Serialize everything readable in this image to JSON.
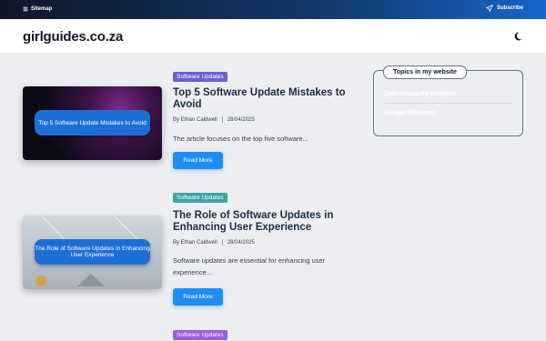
{
  "topbar": {
    "sitemap_label": "Sitemap",
    "subscribe_label": "Subscribe"
  },
  "header": {
    "logo": "girlguides.co.za"
  },
  "posts": [
    {
      "tag": "Software Updates",
      "title": "Top 5 Software Update Mistakes to Avoid",
      "thumb_text": "Top 5 Software Update Mistakes to Avoid",
      "author": "By Ethan Caldwell",
      "date": "28/04/2025",
      "excerpt": "The article focuses on the top five software...",
      "button": "Read More"
    },
    {
      "tag": "Software Updates",
      "title": "The Role of Software Updates in Enhancing User Experience",
      "thumb_text": "The Role of Software Updates in Enhancing User Experience",
      "author": "By Ethan Caldwell",
      "date": "28/04/2025",
      "excerpt": "Software updates are essential for enhancing user experience...",
      "button": "Read More"
    },
    {
      "tag": "Software Updates"
    }
  ],
  "sidebar": {
    "heading": "Topics in my website",
    "items": [
      "Cybersecurity Insights",
      "Gadget Reviews"
    ]
  },
  "colors": {
    "accent": "#1e8ef5",
    "topbar_start": "#0f1729",
    "topbar_end": "#1766c9",
    "tag1": "#6d5ed6",
    "tag2": "#3aa6a6",
    "tag3": "#9b5de0"
  },
  "icons": {
    "sitemap": "sitemap-icon",
    "subscribe": "send-icon",
    "theme": "moon-icon"
  }
}
